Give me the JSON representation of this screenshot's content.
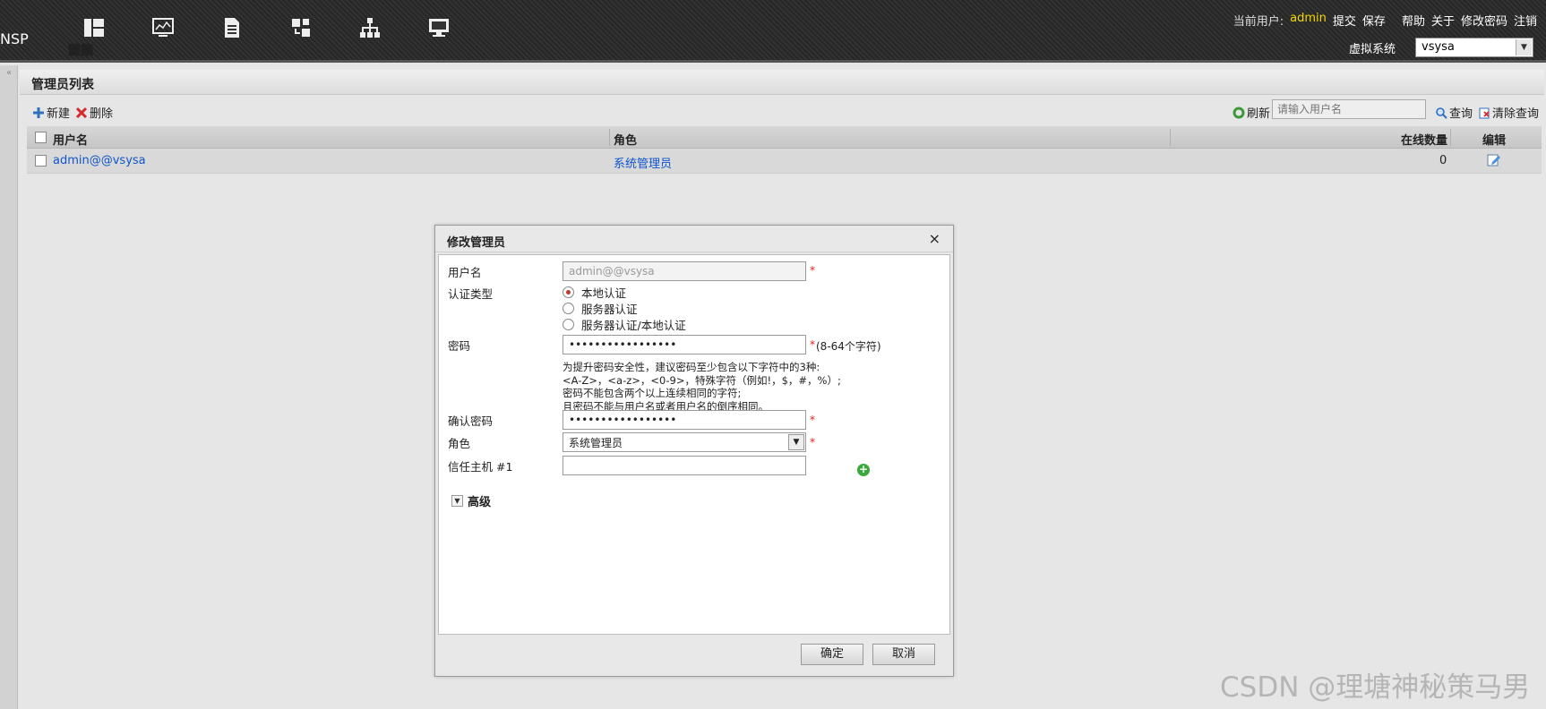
{
  "header": {
    "brand": "NSP",
    "nav": [
      {
        "label": "面板",
        "icon": "dashboard-icon"
      },
      {
        "label": "监控",
        "icon": "monitor-icon"
      },
      {
        "label": "策略",
        "icon": "policy-icon"
      },
      {
        "label": "对象",
        "icon": "object-icon"
      },
      {
        "label": "网络",
        "icon": "network-icon"
      },
      {
        "label": "系统",
        "icon": "system-icon"
      }
    ],
    "current_user_label": "当前用户:",
    "current_user": "admin",
    "links": {
      "submit": "提交",
      "save": "保存",
      "help": "帮助",
      "about": "关于",
      "change_password": "修改密码",
      "logout": "注销"
    },
    "virtual_system_label": "虚拟系统",
    "virtual_system_value": "vsysa"
  },
  "panel": {
    "title": "管理员列表",
    "toolbar": {
      "new": "新建",
      "delete": "删除",
      "refresh": "刷新",
      "search_placeholder": "请输入用户名",
      "query": "查询",
      "clear_query": "清除查询"
    },
    "table": {
      "columns": [
        "用户名",
        "角色",
        "在线数量",
        "编辑"
      ],
      "rows": [
        {
          "username": "admin@@vsysa",
          "role": "系统管理员",
          "online": "0"
        }
      ]
    }
  },
  "dialog": {
    "title": "修改管理员",
    "close": "×",
    "username_label": "用户名",
    "username_value": "admin@@vsysa",
    "auth_type_label": "认证类型",
    "auth_options": [
      "本地认证",
      "服务器认证",
      "服务器认证/本地认证"
    ],
    "auth_selected": "本地认证",
    "password_label": "密码",
    "password_value": "•••••••••••••••••",
    "password_note": "(8-64个字符)",
    "password_hint": [
      "为提升密码安全性，建议密码至少包含以下字符中的3种:",
      "<A-Z>，<a-z>，<0-9>，特殊字符（例如!，$，#，%）;",
      "密码不能包含两个以上连续相同的字符;",
      "且密码不能与用户名或者用户名的倒序相同。"
    ],
    "confirm_password_label": "确认密码",
    "confirm_password_value": "•••••••••••••••••",
    "role_label": "角色",
    "role_value": "系统管理员",
    "trusted_host_label": "信任主机 #1",
    "trusted_host_value": "",
    "advanced_label": "高级",
    "ok": "确定",
    "cancel": "取消",
    "required_mark": "*"
  },
  "watermark": "CSDN @理塘神秘策马男"
}
